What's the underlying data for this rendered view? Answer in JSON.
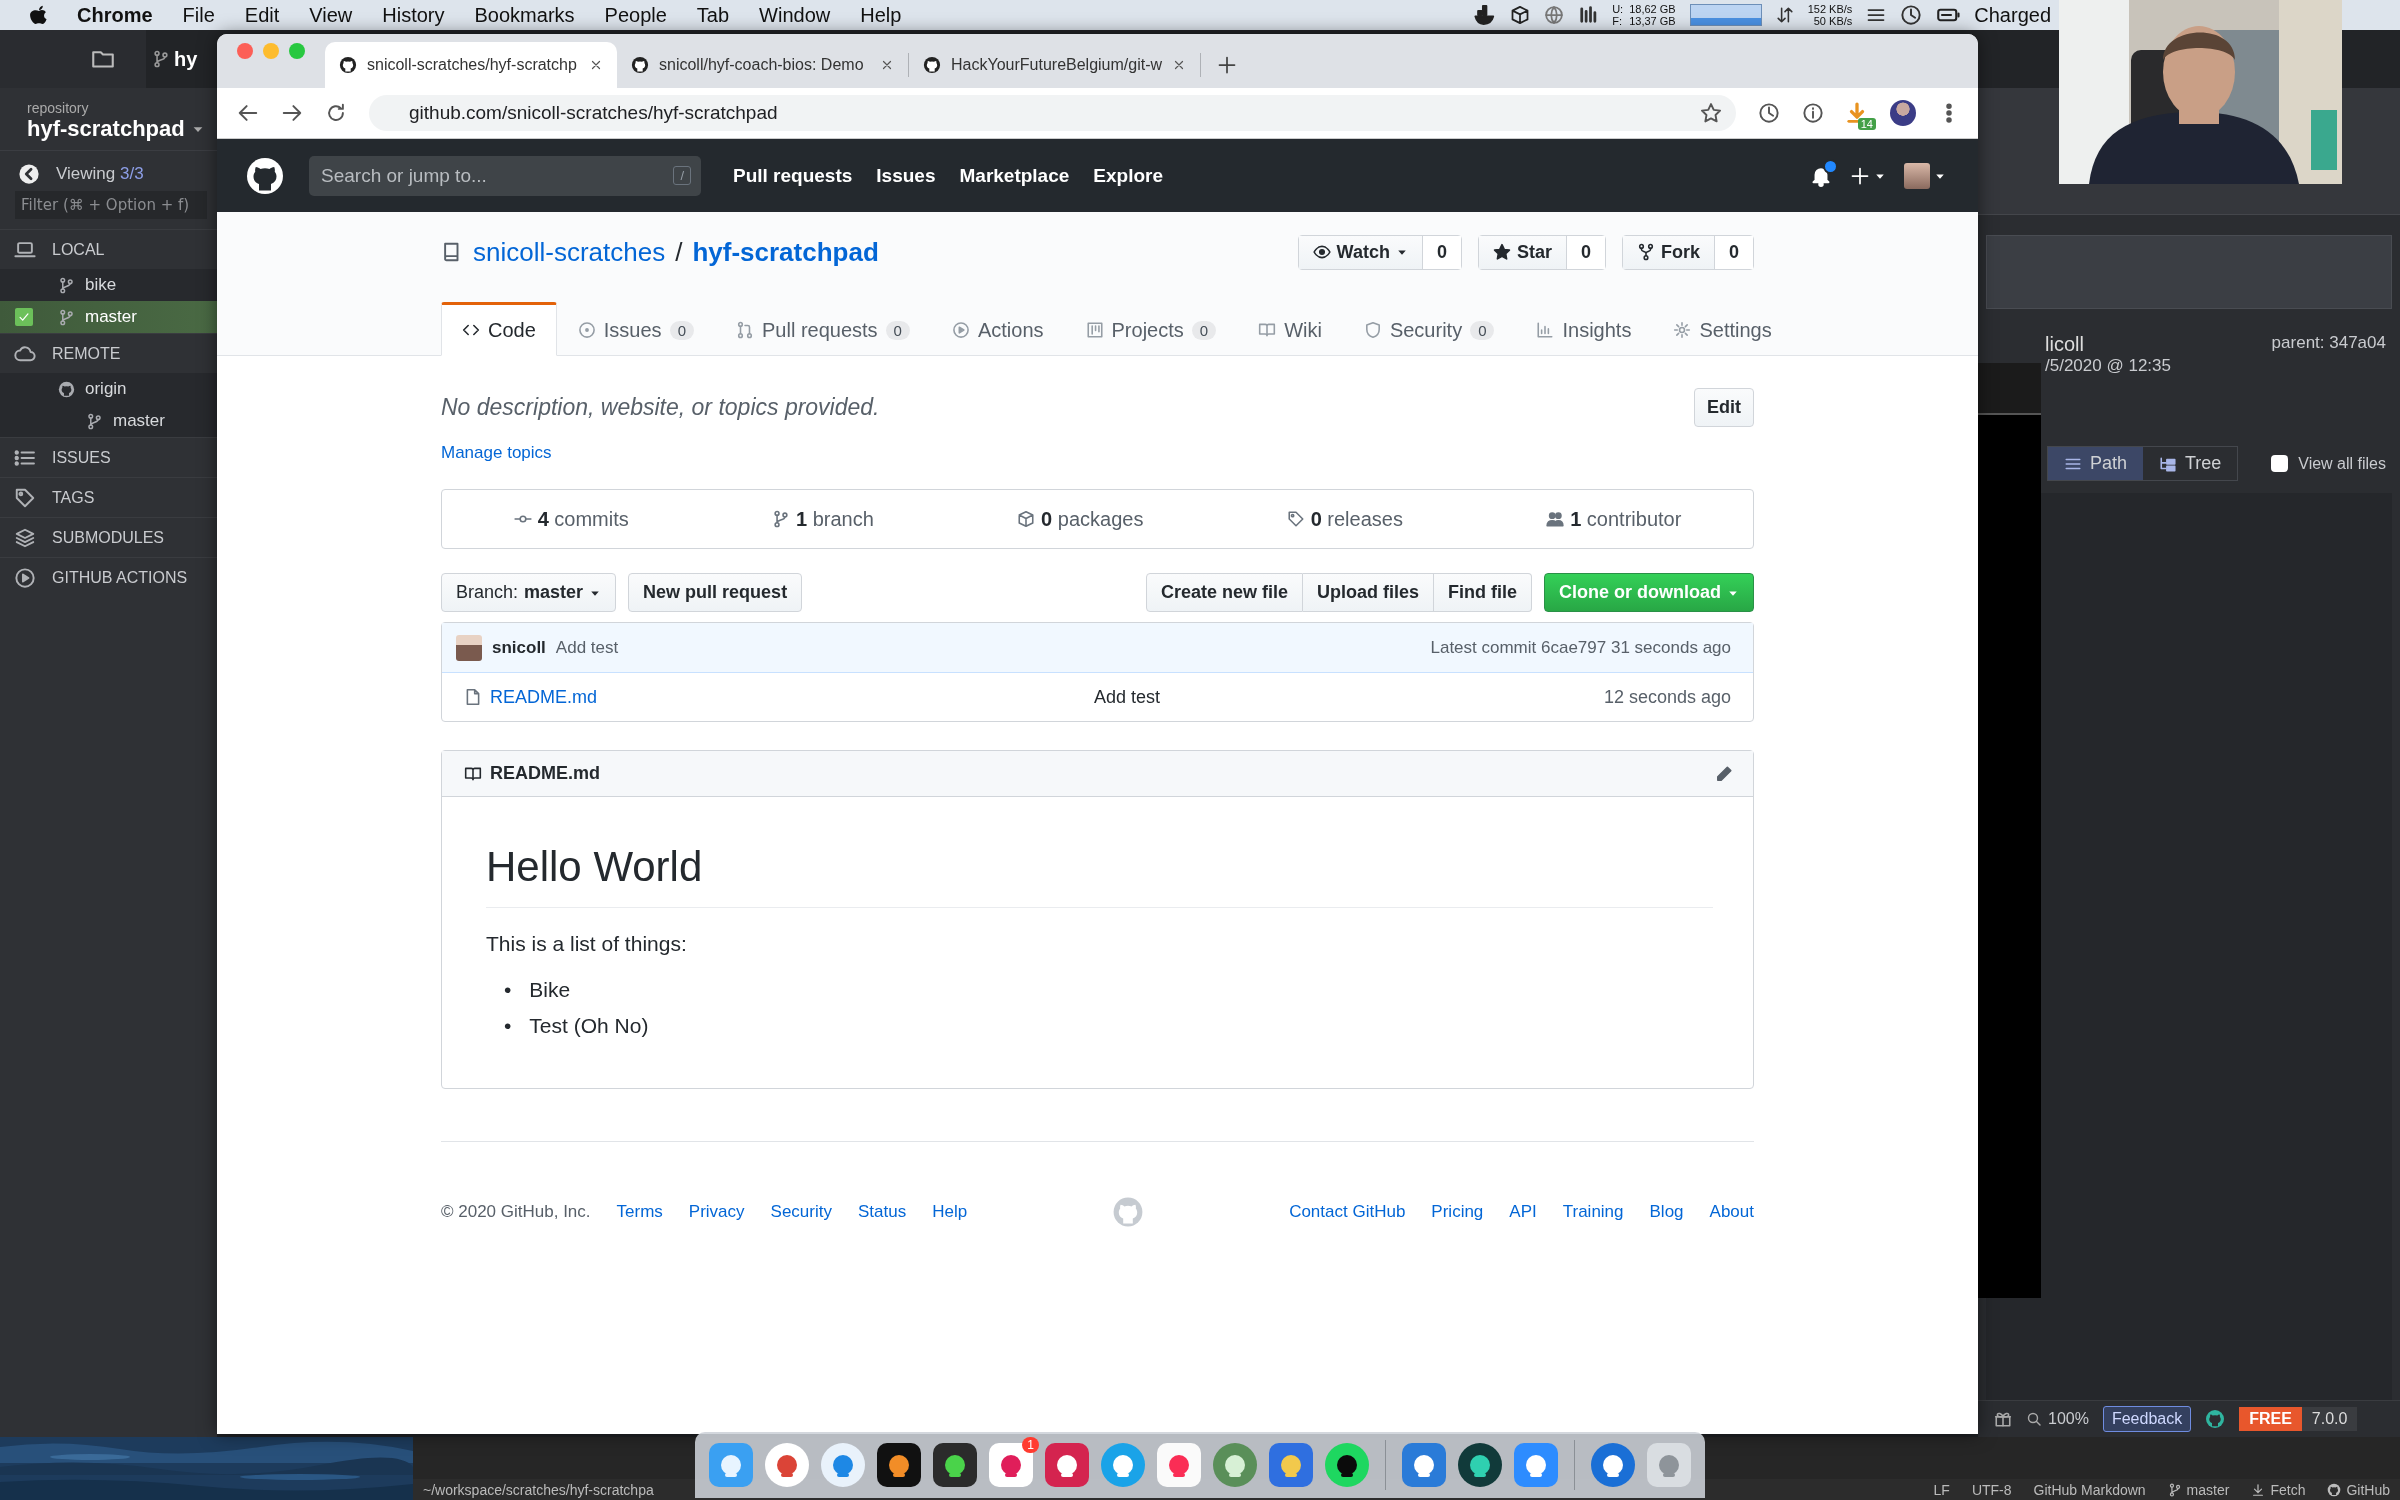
{
  "menu_bar": {
    "app": "Chrome",
    "items": [
      "File",
      "Edit",
      "View",
      "History",
      "Bookmarks",
      "People",
      "Tab",
      "Window",
      "Help"
    ],
    "disk": [
      {
        "label": "U:",
        "value": "18,62 GB"
      },
      {
        "label": "F:",
        "value": "13,37 GB"
      }
    ],
    "network": [
      "152 KB/s",
      "50 KB/s"
    ],
    "battery": "Charged"
  },
  "gitkraken": {
    "tab": "hy",
    "repo_label": "repository",
    "repo_name": "hyf-scratchpad",
    "viewing": {
      "label": "Viewing",
      "count": "3/3"
    },
    "filter": {
      "placeholder": "Filter (⌘ + Option + f)"
    },
    "sections": [
      {
        "kind": "local",
        "label": "LOCAL",
        "children": [
          {
            "kind": "branch",
            "label": "bike",
            "selected": false,
            "checked": false
          },
          {
            "kind": "branch",
            "label": "master",
            "selected": true,
            "checked": true
          }
        ]
      },
      {
        "kind": "remote",
        "label": "REMOTE",
        "children": [
          {
            "kind": "remote",
            "label": "origin",
            "selected": false,
            "checked": false,
            "children": [
              {
                "kind": "branch",
                "label": "master",
                "selected": false,
                "checked": false
              }
            ]
          }
        ]
      },
      {
        "kind": "issues",
        "label": "ISSUES"
      },
      {
        "kind": "tags",
        "label": "TAGS"
      },
      {
        "kind": "submodules",
        "label": "SUBMODULES"
      },
      {
        "kind": "actions",
        "label": "GITHUB ACTIONS"
      }
    ],
    "commit": {
      "author": "licoll",
      "date": "/5/2020 @ 12:35",
      "parent_label": "parent:",
      "parent": "347a04"
    },
    "views": [
      {
        "kind": "path",
        "label": "Path",
        "selected": true
      },
      {
        "kind": "tree",
        "label": "Tree",
        "selected": false
      }
    ],
    "view_all_files": {
      "label": "View all files",
      "checked": false
    },
    "footer": {
      "zoom": "100%",
      "feedback": "Feedback",
      "plan": "FREE",
      "version": "7.0.0"
    }
  },
  "browser": {
    "tabs": [
      {
        "title": "snicoll-scratches/hyf-scratchp",
        "selected": true
      },
      {
        "title": "snicoll/hyf-coach-bios: Demo",
        "selected": false
      },
      {
        "title": "HackYourFutureBelgium/git-w",
        "selected": false
      }
    ],
    "address": "github.com/snicoll-scratches/hyf-scratchpad",
    "extension_badge": "14"
  },
  "github": {
    "header": {
      "search": {
        "placeholder": "Search or jump to...",
        "key": "/"
      },
      "nav": [
        "Pull requests",
        "Issues",
        "Marketplace",
        "Explore"
      ],
      "unread": true
    },
    "repo": {
      "owner": "snicoll-scratches",
      "separator": "/",
      "name": "hyf-scratchpad",
      "actions": [
        {
          "kind": "watch",
          "label": "Watch",
          "count": "0"
        },
        {
          "kind": "star",
          "label": "Star",
          "count": "0"
        },
        {
          "kind": "fork",
          "label": "Fork",
          "count": "0"
        }
      ]
    },
    "tabs": [
      {
        "kind": "code",
        "label": "Code",
        "selected": true
      },
      {
        "kind": "issues",
        "label": "Issues",
        "count": "0",
        "selected": false
      },
      {
        "kind": "pulls",
        "label": "Pull requests",
        "count": "0",
        "selected": false
      },
      {
        "kind": "actions",
        "label": "Actions",
        "selected": false
      },
      {
        "kind": "projects",
        "label": "Projects",
        "count": "0",
        "selected": false
      },
      {
        "kind": "wiki",
        "label": "Wiki",
        "selected": false
      },
      {
        "kind": "security",
        "label": "Security",
        "count": "0",
        "selected": false
      },
      {
        "kind": "insights",
        "label": "Insights",
        "selected": false
      },
      {
        "kind": "settings",
        "label": "Settings",
        "selected": false
      }
    ],
    "description": "No description, website, or topics provided.",
    "edit": "Edit",
    "manage_topics": "Manage topics",
    "summary": [
      {
        "kind": "commits",
        "count": "4",
        "label": "commits"
      },
      {
        "kind": "branch",
        "count": "1",
        "label": "branch"
      },
      {
        "kind": "packages",
        "count": "0",
        "label": "packages"
      },
      {
        "kind": "releases",
        "count": "0",
        "label": "releases"
      },
      {
        "kind": "contributors",
        "count": "1",
        "label": "contributor"
      }
    ],
    "branch": {
      "label": "Branch:",
      "value": "master"
    },
    "new_pull_request": "New pull request",
    "file_actions": [
      "Create new file",
      "Upload files",
      "Find file"
    ],
    "clone": "Clone or download",
    "latest_commit": {
      "author": "snicoll",
      "message": "Add test",
      "label": "Latest commit",
      "sha": "6cae797",
      "time": "31 seconds ago"
    },
    "files": [
      {
        "kind": "file",
        "name": "README.md",
        "message": "Add test",
        "time": "12 seconds ago"
      }
    ],
    "readme": {
      "title": "README.md",
      "heading": "Hello World",
      "paragraph": "This is a list of things:",
      "items": [
        {
          "marker": "•",
          "text": "Bike"
        },
        {
          "marker": "•",
          "text": "Test (Oh No)"
        }
      ]
    },
    "footer": {
      "copyright": "© 2020 GitHub, Inc.",
      "left_links": [
        "Terms",
        "Privacy",
        "Security",
        "Status",
        "Help"
      ],
      "right_links": [
        "Contact GitHub",
        "Pricing",
        "API",
        "Training",
        "Blog",
        "About"
      ]
    }
  },
  "dock": {
    "apps": [
      {
        "kind": "finder"
      },
      {
        "kind": "chrome"
      },
      {
        "kind": "safari"
      },
      {
        "kind": "ide"
      },
      {
        "kind": "terminal"
      },
      {
        "kind": "slack",
        "badge": "1"
      },
      {
        "kind": "red"
      },
      {
        "kind": "skype"
      },
      {
        "kind": "music"
      },
      {
        "kind": "atom"
      },
      {
        "kind": "keynote"
      },
      {
        "kind": "spotify"
      },
      {
        "kind": "separator"
      },
      {
        "kind": "vscode"
      },
      {
        "kind": "kraken"
      },
      {
        "kind": "zoom"
      },
      {
        "kind": "separator"
      },
      {
        "kind": "password"
      },
      {
        "kind": "trash"
      }
    ]
  },
  "editor_status": {
    "path": "~/workspace/scratches/hyf-scratchpa",
    "items": [
      {
        "kind": "text",
        "label": "LF"
      },
      {
        "kind": "text",
        "label": "UTF-8"
      },
      {
        "kind": "text",
        "label": "GitHub Markdown"
      },
      {
        "kind": "branch",
        "label": "master"
      },
      {
        "kind": "fetch",
        "label": "Fetch"
      },
      {
        "kind": "github",
        "label": "GitHub"
      }
    ]
  }
}
